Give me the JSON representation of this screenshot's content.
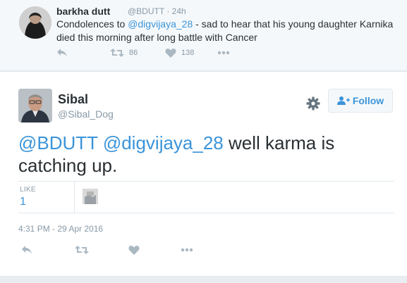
{
  "parent_tweet": {
    "name": "barkha dutt",
    "handle": "@BDUTT",
    "time": "24h",
    "text_pre": "Condolences to ",
    "mention": "@digvijaya_28",
    "text_post": " - sad to hear that his young daughter Karnika died this morning after long battle with Cancer",
    "retweets": "86",
    "likes": "138"
  },
  "tweet": {
    "name": "Sibal",
    "handle": "@Sibal_Dog",
    "follow_label": "Follow",
    "mention1": "@BDUTT",
    "mention2": "@digvijaya_28",
    "text": " well karma is catching up.",
    "like_label": "LIKE",
    "like_count": "1",
    "timestamp": "4:31 PM - 29 Apr 2016"
  },
  "colors": {
    "link": "#3b94d9",
    "icon": "#aab8c2",
    "muted": "#8899a6"
  }
}
